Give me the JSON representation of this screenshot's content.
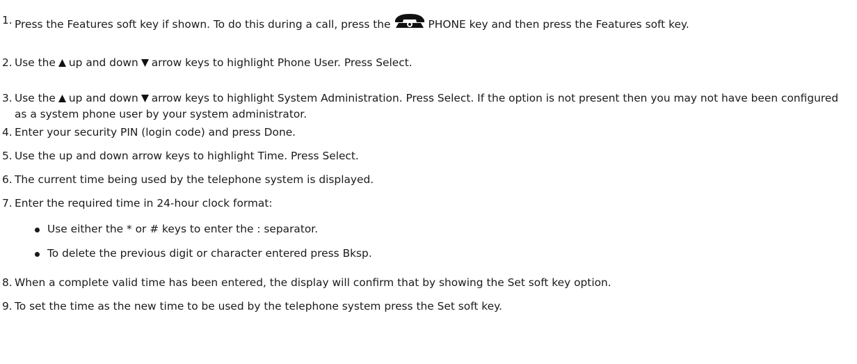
{
  "steps": [
    {
      "num": "1.",
      "a": "Press the Features soft key if shown. To do this during a call, press the",
      "b": "PHONE key and then press the Features soft key.",
      "icon": "telephone-icon"
    },
    {
      "num": "2.",
      "a": "Use the",
      "b": "up and down",
      "c": "arrow keys to highlight Phone User. Press Select.",
      "icons": [
        "up-arrow-icon",
        "down-arrow-icon"
      ]
    },
    {
      "num": "3.",
      "a": "Use the",
      "b": "up and down",
      "c": "arrow keys to highlight System Administration. Press Select. If the option is not present then you may not have been configured as a system phone user by your system administrator.",
      "icons": [
        "up-arrow-icon",
        "down-arrow-icon"
      ]
    },
    {
      "num": "4.",
      "text": "Enter your security PIN (login code) and press Done."
    },
    {
      "num": "5.",
      "text": "Use the up and down arrow keys to highlight Time. Press Select."
    },
    {
      "num": "6.",
      "text": "The current time being used by the telephone system is displayed."
    },
    {
      "num": "7.",
      "text": "Enter the required time in 24-hour clock format:"
    },
    {
      "num": "8.",
      "text": "When a complete valid time has been entered, the display will confirm that by showing the Set soft key option."
    },
    {
      "num": "9.",
      "text": "To set the time as the new time to be used by the telephone system press the Set soft key."
    }
  ],
  "bullets": [
    "Use either the * or # keys to enter the : separator.",
    "To delete the previous digit or character entered press Bksp."
  ]
}
